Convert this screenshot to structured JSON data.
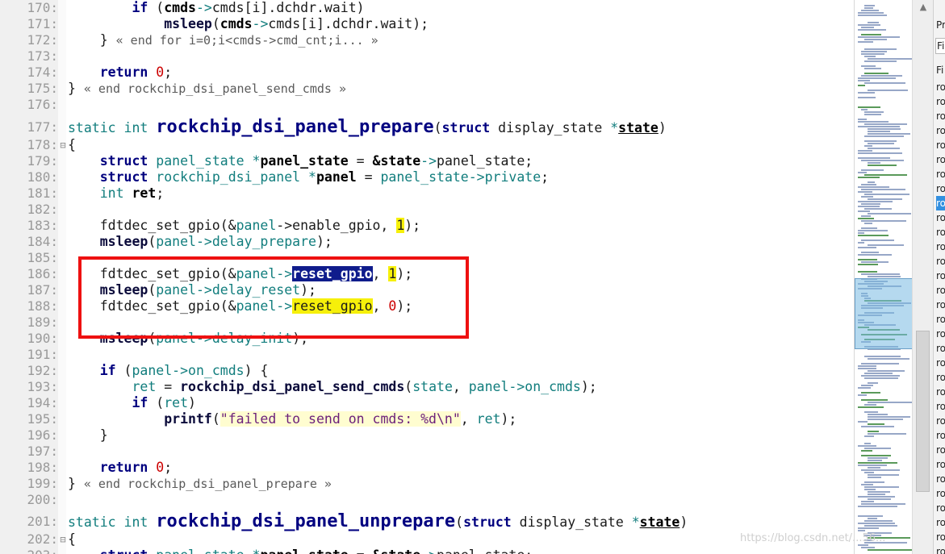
{
  "editor": {
    "lines": [
      {
        "num": "170:",
        "fold": "",
        "tokens": [
          {
            "t": "        "
          },
          {
            "t": "if",
            "c": "kw"
          },
          {
            "t": " ("
          },
          {
            "t": "cmds",
            "c": "var"
          },
          {
            "t": "->",
            "c": "mem"
          },
          {
            "t": "cmds[i].dchdr.wait)"
          }
        ]
      },
      {
        "num": "171:",
        "fold": "",
        "tokens": [
          {
            "t": "            "
          },
          {
            "t": "msleep",
            "c": "fn"
          },
          {
            "t": "("
          },
          {
            "t": "cmds",
            "c": "var"
          },
          {
            "t": "->",
            "c": "mem"
          },
          {
            "t": "cmds[i].dchdr.wait);"
          }
        ]
      },
      {
        "num": "172:",
        "fold": "",
        "tokens": [
          {
            "t": "    } "
          },
          {
            "t": "« end for i=0;i<cmds->cmd_cnt;i... »",
            "c": "com"
          }
        ]
      },
      {
        "num": "173:",
        "fold": "",
        "tokens": []
      },
      {
        "num": "174:",
        "fold": "",
        "tokens": [
          {
            "t": "    "
          },
          {
            "t": "return",
            "c": "kw"
          },
          {
            "t": " "
          },
          {
            "t": "0",
            "c": "num"
          },
          {
            "t": ";"
          }
        ]
      },
      {
        "num": "175:",
        "fold": "",
        "tokens": [
          {
            "t": "} "
          },
          {
            "t": "« end rockchip_dsi_panel_send_cmds »",
            "c": "com"
          }
        ]
      },
      {
        "num": "176:",
        "fold": "",
        "tokens": []
      },
      {
        "num": "177:",
        "fold": "",
        "tokens": [
          {
            "t": "static int ",
            "c": "ty"
          },
          {
            "t": "rockchip_dsi_panel_prepare",
            "c": "fnbig"
          },
          {
            "t": "("
          },
          {
            "t": "struct",
            "c": "kw"
          },
          {
            "t": " display_state "
          },
          {
            "t": "*",
            "c": "mem"
          },
          {
            "t": "state",
            "c": "var und"
          },
          {
            "t": ")"
          }
        ]
      },
      {
        "num": "178:",
        "fold": "⊟",
        "tokens": [
          {
            "t": "{"
          }
        ]
      },
      {
        "num": "179:",
        "fold": "",
        "tokens": [
          {
            "t": "    "
          },
          {
            "t": "struct",
            "c": "kw"
          },
          {
            "t": " "
          },
          {
            "t": "panel_state",
            "c": "ty"
          },
          {
            "t": " "
          },
          {
            "t": "*",
            "c": "mem"
          },
          {
            "t": "panel_state",
            "c": "var"
          },
          {
            "t": " = "
          },
          {
            "t": "&state",
            "c": "var"
          },
          {
            "t": "->",
            "c": "mem"
          },
          {
            "t": "panel_state;"
          }
        ]
      },
      {
        "num": "180:",
        "fold": "",
        "tokens": [
          {
            "t": "    "
          },
          {
            "t": "struct",
            "c": "kw"
          },
          {
            "t": " "
          },
          {
            "t": "rockchip_dsi_panel",
            "c": "ty"
          },
          {
            "t": " "
          },
          {
            "t": "*",
            "c": "mem"
          },
          {
            "t": "panel",
            "c": "var"
          },
          {
            "t": " = "
          },
          {
            "t": "panel_state->private",
            "c": "ty"
          },
          {
            "t": ";"
          }
        ]
      },
      {
        "num": "181:",
        "fold": "",
        "tokens": [
          {
            "t": "    "
          },
          {
            "t": "int",
            "c": "ty"
          },
          {
            "t": " "
          },
          {
            "t": "ret",
            "c": "var"
          },
          {
            "t": ";"
          }
        ]
      },
      {
        "num": "182:",
        "fold": "",
        "tokens": []
      },
      {
        "num": "183:",
        "fold": "",
        "tokens": [
          {
            "t": "    fdtdec_set_gpio(&"
          },
          {
            "t": "panel",
            "c": "ty"
          },
          {
            "t": "->enable_gpio, "
          },
          {
            "t": "1",
            "c": "hl-y"
          },
          {
            "t": ");"
          }
        ]
      },
      {
        "num": "184:",
        "fold": "",
        "tokens": [
          {
            "t": "    "
          },
          {
            "t": "msleep",
            "c": "fn"
          },
          {
            "t": "("
          },
          {
            "t": "panel->delay_prepare",
            "c": "ty"
          },
          {
            "t": ");"
          }
        ]
      },
      {
        "num": "185:",
        "fold": "",
        "tokens": []
      },
      {
        "num": "186:",
        "fold": "",
        "tokens": [
          {
            "t": "    fdtdec_set_gpio(&"
          },
          {
            "t": "panel->",
            "c": "ty"
          },
          {
            "t": "reset_gpio",
            "c": "hl-sel"
          },
          {
            "t": ", "
          },
          {
            "t": "1",
            "c": "hl-y"
          },
          {
            "t": ");"
          }
        ]
      },
      {
        "num": "187:",
        "fold": "",
        "tokens": [
          {
            "t": "    "
          },
          {
            "t": "msleep",
            "c": "fn"
          },
          {
            "t": "("
          },
          {
            "t": "panel->delay_reset",
            "c": "ty"
          },
          {
            "t": ");"
          }
        ]
      },
      {
        "num": "188:",
        "fold": "",
        "tokens": [
          {
            "t": "    fdtdec_set_gpio(&"
          },
          {
            "t": "panel->",
            "c": "ty"
          },
          {
            "t": "reset_gpio",
            "c": "hl-y"
          },
          {
            "t": ", "
          },
          {
            "t": "0",
            "c": "num"
          },
          {
            "t": ");"
          }
        ]
      },
      {
        "num": "189:",
        "fold": "",
        "tokens": []
      },
      {
        "num": "190:",
        "fold": "",
        "tokens": [
          {
            "t": "    "
          },
          {
            "t": "msleep",
            "c": "fn"
          },
          {
            "t": "("
          },
          {
            "t": "panel->delay_init",
            "c": "ty"
          },
          {
            "t": ");"
          }
        ]
      },
      {
        "num": "191:",
        "fold": "",
        "tokens": []
      },
      {
        "num": "192:",
        "fold": "",
        "tokens": [
          {
            "t": "    "
          },
          {
            "t": "if",
            "c": "kw"
          },
          {
            "t": " ("
          },
          {
            "t": "panel->on_cmds",
            "c": "ty"
          },
          {
            "t": ") {"
          }
        ]
      },
      {
        "num": "193:",
        "fold": "",
        "tokens": [
          {
            "t": "        "
          },
          {
            "t": "ret",
            "c": "ty"
          },
          {
            "t": " = "
          },
          {
            "t": "rockchip_dsi_panel_send_cmds",
            "c": "fn"
          },
          {
            "t": "("
          },
          {
            "t": "state",
            "c": "ty"
          },
          {
            "t": ", "
          },
          {
            "t": "panel->on_cmds",
            "c": "ty"
          },
          {
            "t": ");"
          }
        ]
      },
      {
        "num": "194:",
        "fold": "",
        "tokens": [
          {
            "t": "        "
          },
          {
            "t": "if",
            "c": "kw"
          },
          {
            "t": " ("
          },
          {
            "t": "ret",
            "c": "ty"
          },
          {
            "t": ")"
          }
        ]
      },
      {
        "num": "195:",
        "fold": "",
        "tokens": [
          {
            "t": "            "
          },
          {
            "t": "printf",
            "c": "fn"
          },
          {
            "t": "("
          },
          {
            "t": "\"failed to send on cmds: %d\\n\"",
            "c": "hl-str"
          },
          {
            "t": ", "
          },
          {
            "t": "ret",
            "c": "ty"
          },
          {
            "t": ");"
          }
        ]
      },
      {
        "num": "196:",
        "fold": "",
        "tokens": [
          {
            "t": "    }"
          }
        ]
      },
      {
        "num": "197:",
        "fold": "",
        "tokens": []
      },
      {
        "num": "198:",
        "fold": "",
        "tokens": [
          {
            "t": "    "
          },
          {
            "t": "return",
            "c": "kw"
          },
          {
            "t": " "
          },
          {
            "t": "0",
            "c": "num"
          },
          {
            "t": ";"
          }
        ]
      },
      {
        "num": "199:",
        "fold": "",
        "tokens": [
          {
            "t": "} "
          },
          {
            "t": "« end rockchip_dsi_panel_prepare »",
            "c": "com"
          }
        ]
      },
      {
        "num": "200:",
        "fold": "",
        "tokens": []
      },
      {
        "num": "201:",
        "fold": "",
        "tokens": [
          {
            "t": "static int ",
            "c": "ty"
          },
          {
            "t": "rockchip_dsi_panel_unprepare",
            "c": "fnbig"
          },
          {
            "t": "("
          },
          {
            "t": "struct",
            "c": "kw"
          },
          {
            "t": " display_state "
          },
          {
            "t": "*",
            "c": "mem"
          },
          {
            "t": "state",
            "c": "var und"
          },
          {
            "t": ")"
          }
        ]
      },
      {
        "num": "202:",
        "fold": "⊟",
        "tokens": [
          {
            "t": "{"
          }
        ]
      },
      {
        "num": "203:",
        "fold": "",
        "tokens": [
          {
            "t": "    "
          },
          {
            "t": "struct",
            "c": "kw"
          },
          {
            "t": " "
          },
          {
            "t": "panel_state",
            "c": "ty"
          },
          {
            "t": " "
          },
          {
            "t": "*",
            "c": "mem"
          },
          {
            "t": "panel_state",
            "c": "var"
          },
          {
            "t": " = "
          },
          {
            "t": "&state",
            "c": "var"
          },
          {
            "t": "->",
            "c": "mem"
          },
          {
            "t": "panel_state;"
          }
        ]
      }
    ]
  },
  "side_panel": {
    "search_label": "Pr",
    "filter_placeholder": "Fil",
    "header": "Fi",
    "items": [
      "ro",
      "ro",
      "ro",
      "ro",
      "ro",
      "ro",
      "ro",
      "ro",
      "ro",
      "ro",
      "ro",
      "ro",
      "ro",
      "ro",
      "ro",
      "ro",
      "ro",
      "ro",
      "ro",
      "ro",
      "ro",
      "ro",
      "ro",
      "ro",
      "ro",
      "ro",
      "ro",
      "ro",
      "ro",
      "ro",
      "ro",
      "ro",
      "ro"
    ],
    "selected_index": 8
  },
  "scrollbar": {
    "up_icon": "chevron-up-icon"
  },
  "watermark": "https://blog.csdn.net/...56..."
}
